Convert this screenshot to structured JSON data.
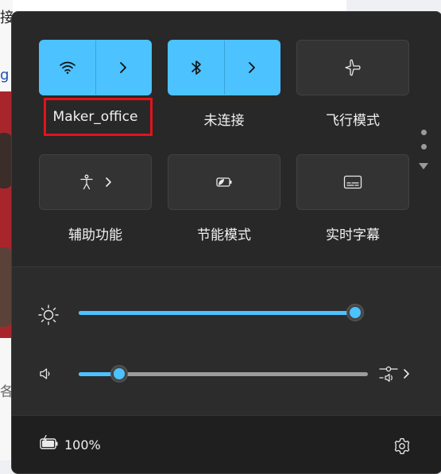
{
  "background": {
    "text_top": "接加明",
    "link_text": "g",
    "text_bottom": "各"
  },
  "quick_settings": {
    "tiles": [
      {
        "id": "wifi",
        "label": "Maker_office",
        "active": true,
        "icon": "wifi-icon",
        "has_arrow": true
      },
      {
        "id": "bluetooth",
        "label": "未连接",
        "active": true,
        "icon": "bluetooth-icon",
        "has_arrow": true
      },
      {
        "id": "airplane",
        "label": "飞行模式",
        "active": false,
        "icon": "airplane-icon",
        "has_arrow": false
      },
      {
        "id": "accessibility",
        "label": "辅助功能",
        "active": false,
        "icon": "accessibility-icon",
        "has_arrow": true
      },
      {
        "id": "battery-saver",
        "label": "节能模式",
        "active": false,
        "icon": "battery-saver-icon",
        "has_arrow": false
      },
      {
        "id": "live-captions",
        "label": "实时字幕",
        "active": false,
        "icon": "live-captions-icon",
        "has_arrow": false
      }
    ],
    "page_indicator": {
      "pages": 2,
      "current": 1
    }
  },
  "sliders": {
    "brightness": {
      "icon": "brightness-icon",
      "value_fraction": 0.99
    },
    "volume": {
      "icon": "speaker-icon",
      "value_fraction": 0.14,
      "output_icon": "audio-output-icon"
    }
  },
  "footer": {
    "battery_icon": "battery-charging-icon",
    "battery_text": "100%",
    "settings_icon": "gear-icon"
  },
  "colors": {
    "accent": "#4cc2ff",
    "panel_bg": "#282828",
    "highlight_box": "#e2131b"
  }
}
